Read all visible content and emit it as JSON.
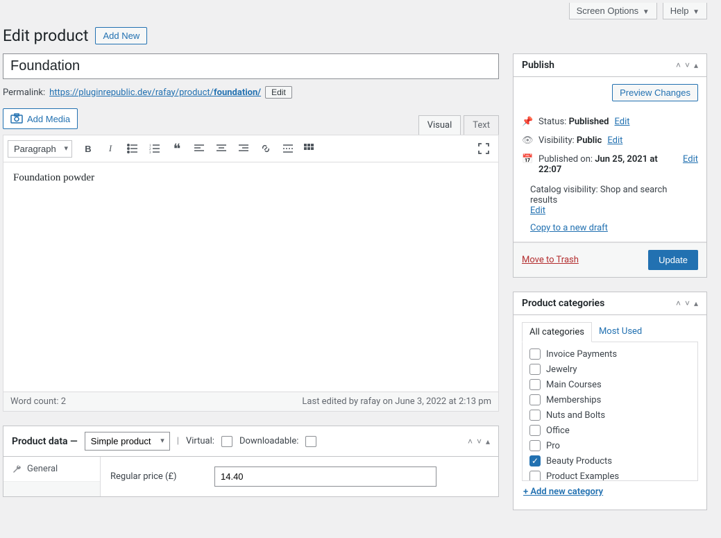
{
  "top": {
    "screen_options": "Screen Options",
    "help": "Help"
  },
  "header": {
    "title": "Edit product",
    "add_new": "Add New"
  },
  "product": {
    "title": "Foundation",
    "permalink_label": "Permalink:",
    "permalink_base": "https://pluginrepublic.dev/rafay/product/",
    "permalink_slug": "foundation/",
    "edit_label": "Edit"
  },
  "editor": {
    "add_media": "Add Media",
    "tab_visual": "Visual",
    "tab_text": "Text",
    "format_option": "Paragraph",
    "content": "Foundation powder",
    "word_count_label": "Word count:",
    "word_count": "2",
    "last_edited": "Last edited by rafay on June 3, 2022 at 2:13 pm"
  },
  "product_data": {
    "title": "Product data",
    "type": "Simple product",
    "virtual_label": "Virtual:",
    "downloadable_label": "Downloadable:",
    "tab_general": "General",
    "regular_price_label": "Regular price (£)",
    "regular_price": "14.40"
  },
  "publish": {
    "title": "Publish",
    "preview": "Preview Changes",
    "status_label": "Status:",
    "status_value": "Published",
    "visibility_label": "Visibility:",
    "visibility_value": "Public",
    "published_label": "Published on:",
    "published_value": "Jun 25, 2021 at 22:07",
    "catalog_label": "Catalog visibility:",
    "catalog_value": "Shop and search results",
    "edit": "Edit",
    "copy": "Copy to a new draft",
    "trash": "Move to Trash",
    "update": "Update"
  },
  "categories": {
    "title": "Product categories",
    "tab_all": "All categories",
    "tab_most": "Most Used",
    "items": [
      {
        "label": "Invoice Payments",
        "checked": false
      },
      {
        "label": "Jewelry",
        "checked": false
      },
      {
        "label": "Main Courses",
        "checked": false
      },
      {
        "label": "Memberships",
        "checked": false
      },
      {
        "label": "Nuts and Bolts",
        "checked": false
      },
      {
        "label": "Office",
        "checked": false
      },
      {
        "label": "Pro",
        "checked": false
      },
      {
        "label": "Beauty Products",
        "checked": true
      },
      {
        "label": "Product Examples",
        "checked": false
      }
    ],
    "add_new": "+ Add new category"
  }
}
